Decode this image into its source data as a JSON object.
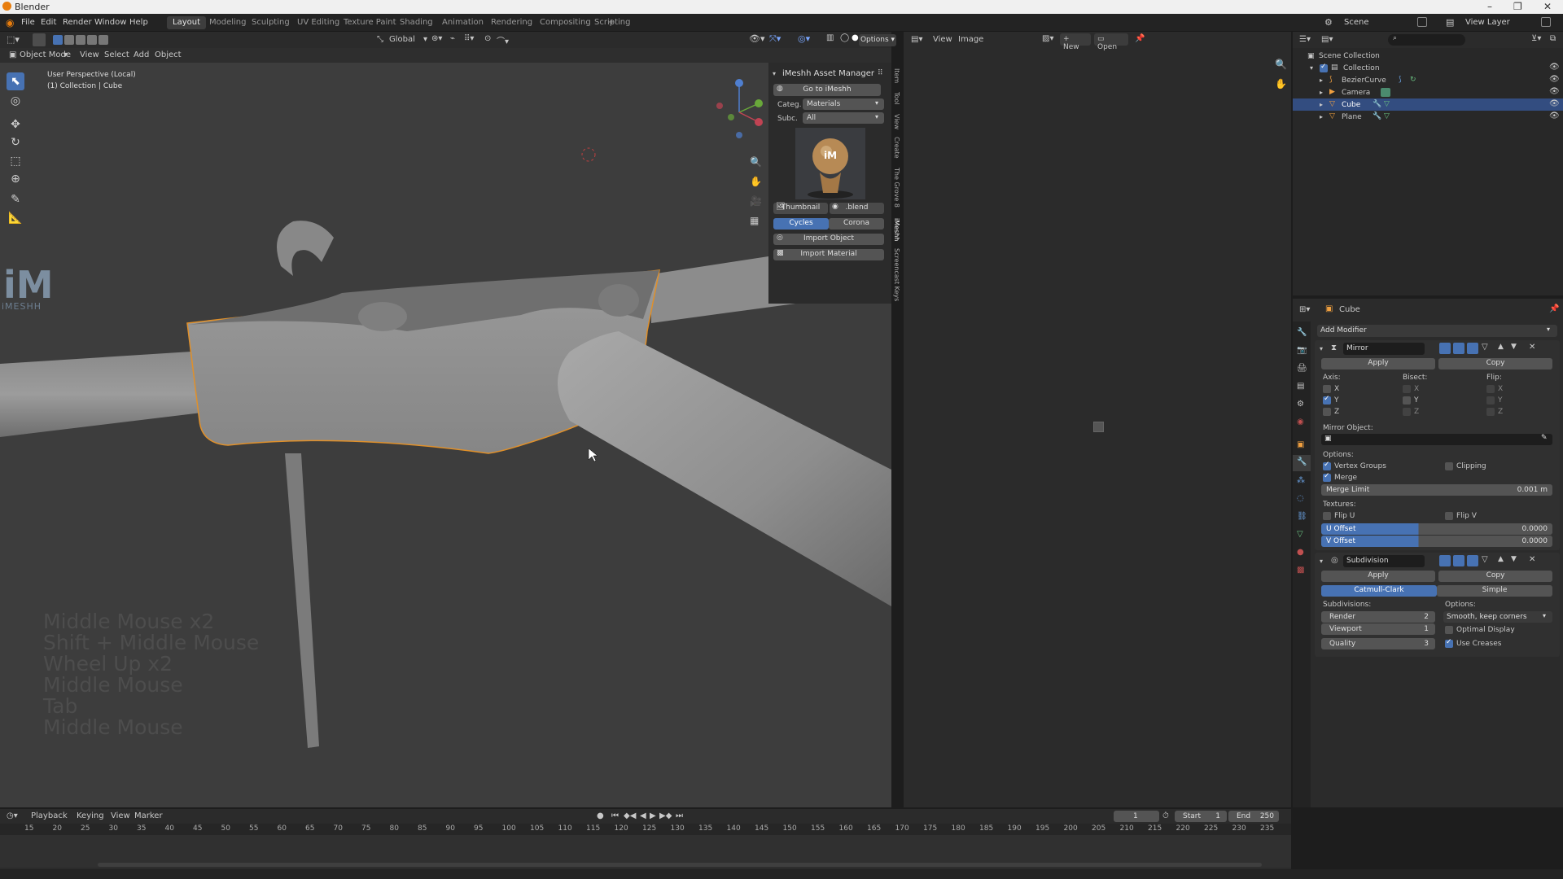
{
  "window": {
    "title": "Blender"
  },
  "menubar": {
    "items": [
      "File",
      "Edit",
      "Render",
      "Window",
      "Help"
    ]
  },
  "workspaces": [
    "Layout",
    "Modeling",
    "Sculpting",
    "UV Editing",
    "Texture Paint",
    "Shading",
    "Animation",
    "Rendering",
    "Compositing",
    "Scripting",
    "+"
  ],
  "scene": {
    "label": "Scene",
    "view_layer": "View Layer"
  },
  "viewport_header": {
    "mode": "Object Mode",
    "menus": [
      "View",
      "Select",
      "Add",
      "Object"
    ],
    "orientation": "Global",
    "options": "Options"
  },
  "viewport": {
    "perspective": "User Perspective (Local)",
    "collection": "(1) Collection | Cube",
    "logo_text": "iMESHH",
    "screencast_keys": [
      "Middle Mouse x2",
      "Shift + Middle Mouse",
      "Wheel Up x2",
      "Middle Mouse",
      "Tab",
      "Middle Mouse"
    ]
  },
  "imeshh_panel": {
    "title": "iMeshh Asset Manager",
    "go_button": "Go to iMeshh",
    "category_label": "Categ.",
    "category_value": "Materials",
    "subcategory_label": "Subc.",
    "subcategory_value": "All",
    "thumbnail_btn": "Thumbnail",
    "blend_btn": ".blend",
    "cycles_btn": "Cycles",
    "corona_btn": "Corona",
    "import_object": "Import Object",
    "import_material": "Import Material",
    "side_tabs": [
      "Item",
      "Tool",
      "View",
      "Create",
      "The Grove 8",
      "iMeshh",
      "Screencast Keys"
    ]
  },
  "image_editor": {
    "menus": [
      "View",
      "Image"
    ],
    "new_btn": "New",
    "open_btn": "Open"
  },
  "outliner": {
    "root": "Scene Collection",
    "items": [
      {
        "name": "Collection"
      },
      {
        "name": "BezierCurve"
      },
      {
        "name": "Camera"
      },
      {
        "name": "Cube"
      },
      {
        "name": "Plane"
      }
    ]
  },
  "properties": {
    "object_name": "Cube",
    "add_modifier": "Add Modifier",
    "mirror": {
      "name": "Mirror",
      "apply": "Apply",
      "copy": "Copy",
      "axis_label": "Axis:",
      "bisect_label": "Bisect:",
      "flip_label": "Flip:",
      "axes": [
        "X",
        "Y",
        "Z"
      ],
      "mirror_object_label": "Mirror Object:",
      "options_label": "Options:",
      "vertex_groups": "Vertex Groups",
      "clipping": "Clipping",
      "merge": "Merge",
      "merge_limit_label": "Merge Limit",
      "merge_limit_value": "0.001 m",
      "textures_label": "Textures:",
      "flip_u": "Flip U",
      "flip_v": "Flip V",
      "u_offset_label": "U Offset",
      "u_offset_value": "0.0000",
      "v_offset_label": "V Offset",
      "v_offset_value": "0.0000"
    },
    "subdivision": {
      "name": "Subdivision",
      "apply": "Apply",
      "copy": "Copy",
      "catmull": "Catmull-Clark",
      "simple": "Simple",
      "subdivisions_label": "Subdivisions:",
      "options_label": "Options:",
      "render_label": "Render",
      "render_value": "2",
      "viewport_label": "Viewport",
      "viewport_value": "1",
      "quality_label": "Quality",
      "quality_value": "3",
      "uv_mode": "Smooth, keep corners",
      "optimal_display": "Optimal Display",
      "use_creases": "Use Creases"
    }
  },
  "timeline": {
    "menus": [
      "Playback",
      "Keying",
      "View",
      "Marker"
    ],
    "current_frame": "1",
    "start_label": "Start",
    "start_value": "1",
    "end_label": "End",
    "end_value": "250",
    "ticks": [
      "15",
      "20",
      "25",
      "30",
      "35",
      "40",
      "45",
      "50",
      "55",
      "60",
      "65",
      "70",
      "75",
      "80",
      "85",
      "90",
      "95",
      "100",
      "105",
      "110",
      "115",
      "120",
      "125",
      "130",
      "135",
      "140",
      "145",
      "150",
      "155",
      "160",
      "165",
      "170",
      "175",
      "180",
      "185",
      "190",
      "195",
      "200",
      "205",
      "210",
      "215",
      "220",
      "225",
      "230",
      "235"
    ]
  }
}
